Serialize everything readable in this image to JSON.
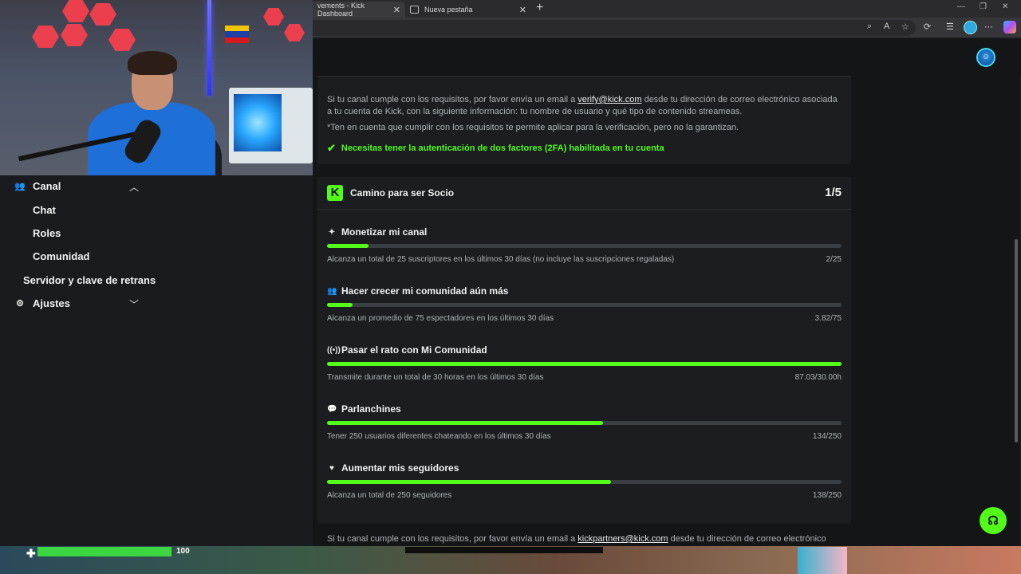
{
  "browser": {
    "tabs": [
      {
        "title": "vements - Kick Dashboard",
        "active": true
      },
      {
        "title": "Nueva pestaña",
        "active": false
      }
    ],
    "new_tab_glyph": "+",
    "window_controls": [
      "—",
      "❐",
      "✕"
    ]
  },
  "sidebar": {
    "items": [
      {
        "label": "Canal",
        "icon": "users-icon",
        "expanded": true
      },
      {
        "label": "Chat"
      },
      {
        "label": "Roles"
      },
      {
        "label": "Comunidad"
      },
      {
        "label": "Servidor y clave de retrans"
      },
      {
        "label": "Ajustes",
        "icon": "gear-icon",
        "expanded": false
      }
    ]
  },
  "verification": {
    "text_before_link": "Si tu canal cumple con los requisitos, por favor envía un email a ",
    "link": "verify@kick.com",
    "text_after_link": " desde tu dirección de correo electrónico asociada a tu cuenta de Kick, con la siguiente información: tu nombre de usuario y qué tipo de contenido streameas.",
    "note": "*Ten en cuenta que cumplir con los requisitos te permite aplicar para la verificación, pero no la garantizan.",
    "requirement_ok": "Necesitas tener la autenticación de dos factores (2FA) habilitada en tu cuenta"
  },
  "partner": {
    "logo_letter": "K",
    "title": "Camino para ser Socio",
    "count": "1/5",
    "goals": [
      {
        "icon": "sparkle-icon",
        "glyph": "✦",
        "title": "Monetizar mi canal",
        "desc": "Alcanza un total de 25 suscriptores en los últimos 30 días (no incluye las suscripciones regaladas)",
        "value": "2/25",
        "progress": 0.08
      },
      {
        "icon": "users-icon",
        "glyph": "👥",
        "title": "Hacer crecer mi comunidad aún más",
        "desc": "Alcanza un promedio de 75 espectadores en los últimos 30 días",
        "value": "3.82/75",
        "progress": 0.05
      },
      {
        "icon": "broadcast-icon",
        "glyph": "((•))",
        "title": "Pasar el rato con Mi Comunidad",
        "desc": "Transmite durante un total de 30 horas en los últimos 30 días",
        "value": "87.03/30.00h",
        "progress": 1.0
      },
      {
        "icon": "chat-bubble-icon",
        "glyph": "💬",
        "title": "Parlanchines",
        "desc": "Tener 250 usuarios diferentes chateando en los últimos 30 días",
        "value": "134/250",
        "progress": 0.536
      },
      {
        "icon": "heart-icon",
        "glyph": "♥",
        "title": "Aumentar mis seguidores",
        "desc": "Alcanza un total de 250 seguidores",
        "value": "138/250",
        "progress": 0.552
      }
    ]
  },
  "partner_note": {
    "text_before_link": "Si tu canal cumple con los requisitos, por favor envía un email a ",
    "link": "kickpartners@kick.com",
    "text_after_link": " desde tu dirección de correo electrónico"
  },
  "game_hud": {
    "health_value": "100",
    "health_progress": 1.0
  },
  "colors": {
    "accent": "#53fc18",
    "background": "#141517",
    "card": "#1b1d20"
  }
}
